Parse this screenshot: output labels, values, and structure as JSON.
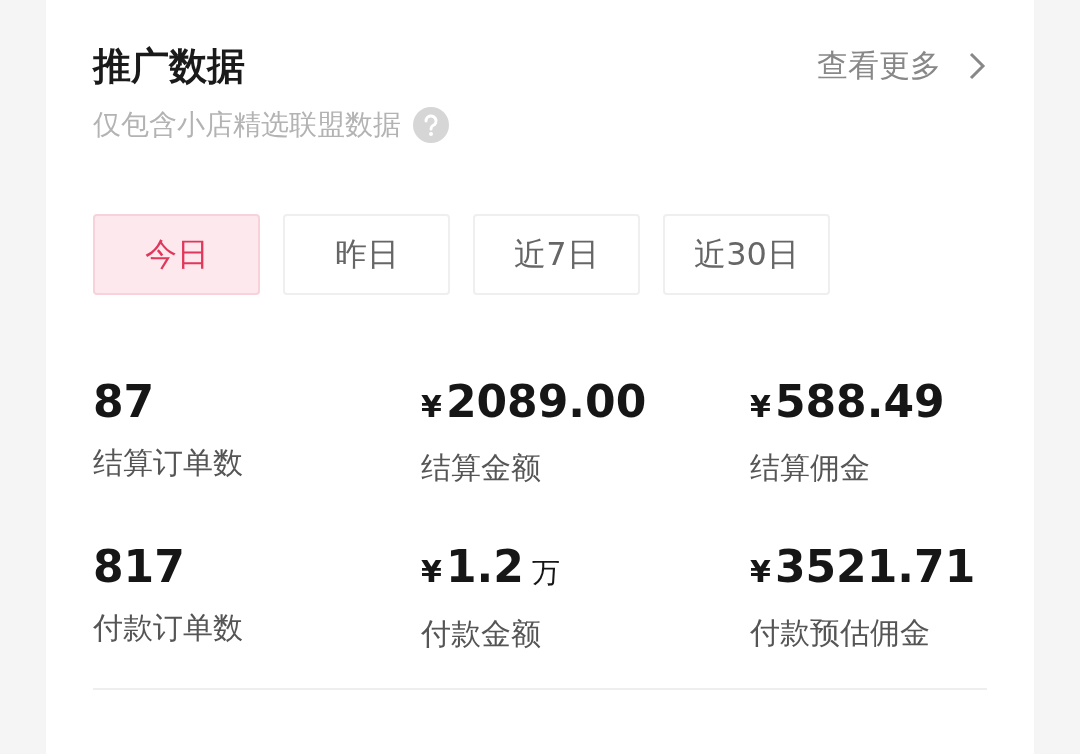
{
  "header": {
    "title": "推广数据",
    "more_link": "查看更多",
    "subtitle": "仅包含小店精选联盟数据"
  },
  "tabs": [
    {
      "label": "今日",
      "selected": true
    },
    {
      "label": "昨日",
      "selected": false
    },
    {
      "label": "近7日",
      "selected": false
    },
    {
      "label": "近30日",
      "selected": false
    }
  ],
  "stats": [
    {
      "value": "87",
      "label": "结算订单数"
    },
    {
      "currency": "¥",
      "value": "2089.00",
      "label": "结算金额"
    },
    {
      "currency": "¥",
      "value": "588.49",
      "label": "结算佣金"
    },
    {
      "value": "817",
      "label": "付款订单数"
    },
    {
      "currency": "¥",
      "value": "1.2",
      "unit": "万",
      "label": "付款金额"
    },
    {
      "currency": "¥",
      "value": "3521.71",
      "label": "付款预估佣金"
    }
  ]
}
